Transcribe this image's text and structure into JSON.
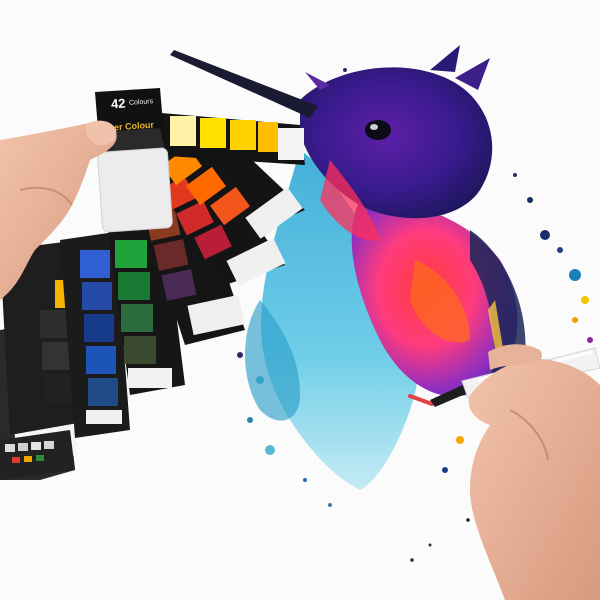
{
  "palette": {
    "count_label": "42",
    "count_sub_label": "Colours",
    "brand_label": "er Colour",
    "brand_color": "#e8b92b"
  },
  "colors": {
    "background": "#fbfbfb",
    "palette_case": "#1f1f1f",
    "skin": "#e9b49a",
    "brush_handle": "#f2f2f2"
  }
}
